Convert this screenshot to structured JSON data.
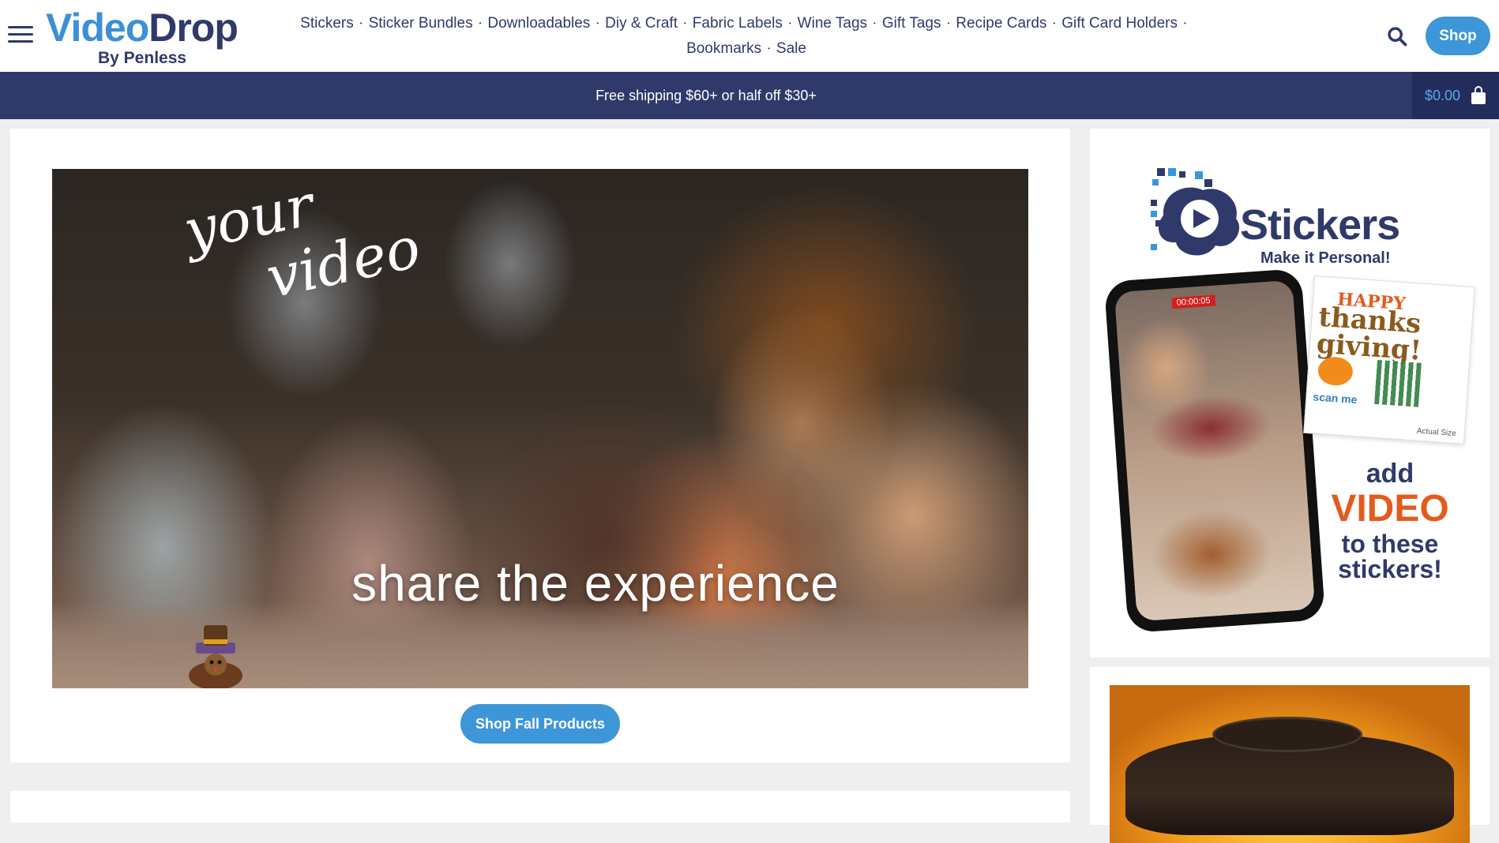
{
  "header": {
    "logo_main_part1": "Video",
    "logo_main_part2": "Drop",
    "logo_sub": "By Penless",
    "nav": [
      "Stickers",
      "Sticker Bundles",
      "Downloadables",
      "Diy & Craft",
      "Fabric Labels",
      "Wine Tags",
      "Gift Tags",
      "Recipe Cards",
      "Gift Card Holders",
      "Bookmarks",
      "Sale"
    ],
    "nav_separator": "•",
    "shop_label": "Shop"
  },
  "banner": {
    "text": "Free shipping $60+ or half off $30+",
    "cart_total": "$0.00"
  },
  "hero": {
    "script_line1": "your",
    "script_line2": "video",
    "tagline": "share the experience",
    "cta": "Shop Fall Products"
  },
  "sidebar_ad": {
    "brand": "Stickers",
    "tagline": "Make it Personal!",
    "timer": "00:00:05",
    "sticker_happy": "HAPPY",
    "sticker_thanks": "thanks",
    "sticker_giving": "giving!",
    "sticker_scan": "scan me",
    "sticker_actual": "Actual Size",
    "add": "add",
    "video": "VIDEO",
    "to_these": "to these",
    "stickers": "stickers!"
  },
  "colors": {
    "navy": "#2f3a6b",
    "accent_blue": "#3d96d8",
    "orange": "#e35b1d"
  },
  "icons": {
    "menu": "hamburger-menu-icon",
    "search": "search-icon",
    "cart": "shopping-bag-icon"
  }
}
